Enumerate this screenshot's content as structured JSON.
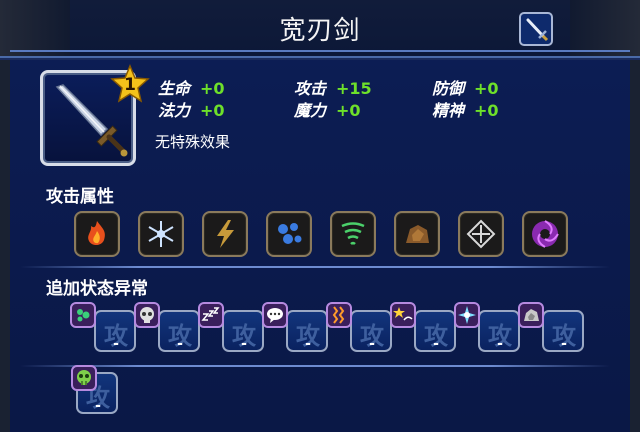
{
  "header": {
    "title": "宽刃剑"
  },
  "item": {
    "level": "1",
    "effect": "无特殊效果",
    "stats": [
      {
        "label": "生命",
        "value": "+0"
      },
      {
        "label": "攻击",
        "value": "+15"
      },
      {
        "label": "防御",
        "value": "+0"
      },
      {
        "label": "法力",
        "value": "+0"
      },
      {
        "label": "魔力",
        "value": "+0"
      },
      {
        "label": "精神",
        "value": "+0"
      }
    ]
  },
  "sections": {
    "attack_attributes": "攻击属性",
    "status_ailments": "追加状态异常"
  },
  "attack_attributes": [
    {
      "name": "fire-icon"
    },
    {
      "name": "ice-icon"
    },
    {
      "name": "lightning-icon"
    },
    {
      "name": "water-icon"
    },
    {
      "name": "wind-icon"
    },
    {
      "name": "earth-icon"
    },
    {
      "name": "holy-icon"
    },
    {
      "name": "dark-icon"
    }
  ],
  "status_ailments": [
    {
      "name": "poison-icon",
      "kanji": "攻",
      "value": "-"
    },
    {
      "name": "death-skull-icon",
      "kanji": "攻",
      "value": "-"
    },
    {
      "name": "sleep-icon",
      "kanji": "攻",
      "value": "-"
    },
    {
      "name": "silence-speech-icon",
      "kanji": "攻",
      "value": "-"
    },
    {
      "name": "paralysis-icon",
      "kanji": "攻",
      "value": "-"
    },
    {
      "name": "confusion-icon",
      "kanji": "攻",
      "value": "-"
    },
    {
      "name": "blind-icon",
      "kanji": "攻",
      "value": "-"
    },
    {
      "name": "petrify-icon",
      "kanji": "攻",
      "value": "-"
    },
    {
      "name": "zombie-icon",
      "kanji": "攻",
      "value": "-"
    }
  ],
  "colors": {
    "background": "#0b1a4e",
    "stat_value": "#6ee02a",
    "badge_border": "#b68ae0",
    "star": "#f5c21a"
  }
}
